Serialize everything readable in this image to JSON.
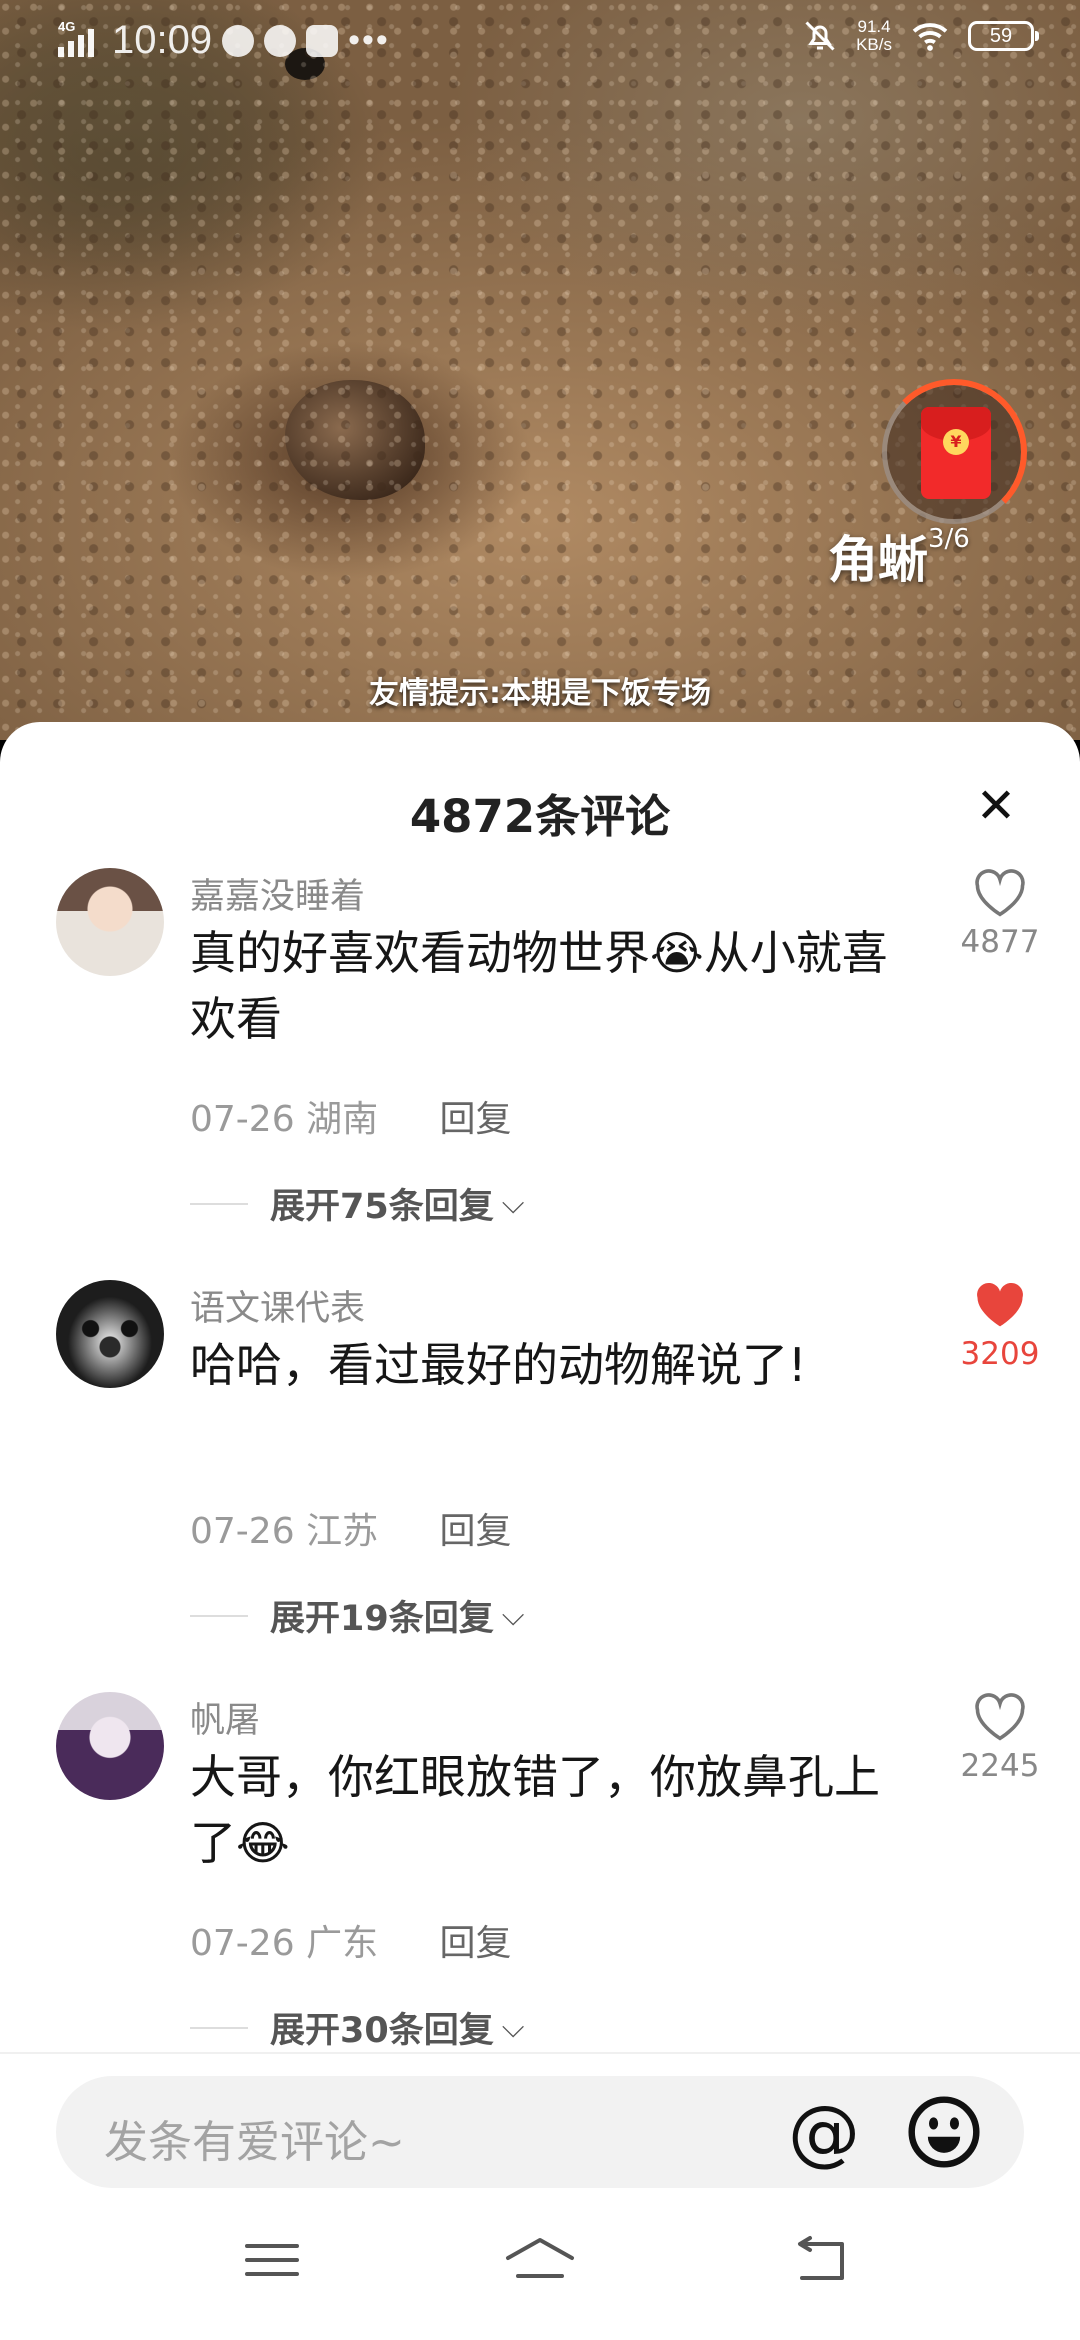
{
  "status_bar": {
    "network": "4G",
    "time": "10:09",
    "more": "•••",
    "speed_value": "91.4",
    "speed_unit": "KB/s",
    "battery": "59"
  },
  "video": {
    "title": "角蜥",
    "progress": "3/6",
    "subtitle": "友情提示:本期是下饭专场"
  },
  "comments_panel": {
    "title": "4872条评论",
    "close": "✕",
    "comments": [
      {
        "username": "嘉嘉没睡着",
        "text": "真的好喜欢看动物世界😭从小就喜欢看",
        "date": "07-26",
        "location": "湖南",
        "reply": "回复",
        "expand": "展开75条回复",
        "likes": "4877",
        "liked": false
      },
      {
        "username": "语文课代表",
        "text": "哈哈，看过最好的动物解说了!",
        "date": "07-26",
        "location": "江苏",
        "reply": "回复",
        "expand": "展开19条回复",
        "likes": "3209",
        "liked": true
      },
      {
        "username": "帆屠",
        "text": "大哥，你红眼放错了，你放鼻孔上了😂",
        "date": "07-26",
        "location": "广东",
        "reply": "回复",
        "expand": "展开30条回复",
        "likes": "2245",
        "liked": false
      }
    ]
  },
  "input": {
    "placeholder": "发条有爱评论~",
    "at_symbol": "@"
  },
  "icons": {
    "like_outline": "heart-outline-icon",
    "like_filled": "heart-filled-icon",
    "emoji": "smiley-icon",
    "nav": [
      "menu-icon",
      "home-icon",
      "back-icon"
    ]
  },
  "colors": {
    "liked": "#e8453c",
    "red_packet": "#f22a2a"
  }
}
